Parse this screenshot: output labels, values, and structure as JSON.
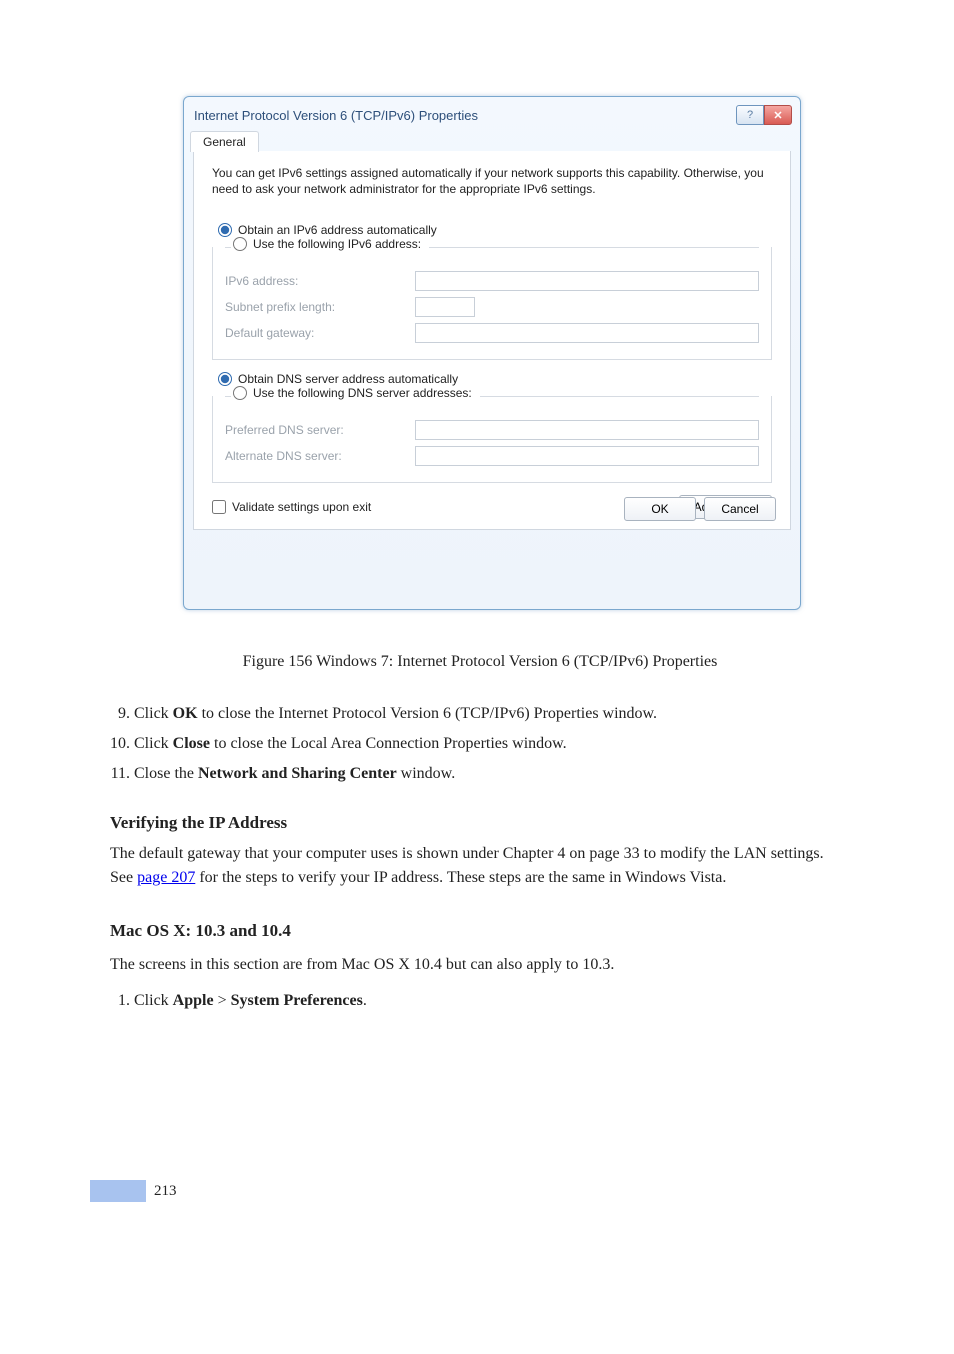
{
  "dialog": {
    "title": "Internet Protocol Version 6 (TCP/IPv6) Properties",
    "tab": "General",
    "description": "You can get IPv6 settings assigned automatically if your network supports this capability. Otherwise, you need to ask your network administrator for the appropriate IPv6 settings.",
    "address": {
      "auto_label": "Obtain an IPv6 address automatically",
      "manual_label": "Use the following IPv6 address:",
      "ipv6_label": "IPv6 address:",
      "prefix_label": "Subnet prefix length:",
      "gateway_label": "Default gateway:",
      "ipv6_value": "",
      "prefix_value": "",
      "gateway_value": ""
    },
    "dns": {
      "auto_label": "Obtain DNS server address automatically",
      "manual_label": "Use the following DNS server addresses:",
      "preferred_label": "Preferred DNS server:",
      "alternate_label": "Alternate DNS server:",
      "preferred_value": "",
      "alternate_value": ""
    },
    "validate_label": "Validate settings upon exit",
    "advanced_label": "Advanced...",
    "ok_label": "OK",
    "cancel_label": "Cancel"
  },
  "figure_caption": "Figure 156   Windows 7: Internet Protocol Version 6 (TCP/IPv6) Properties",
  "steps": {
    "s9_prefix": "Click ",
    "s9_bold": "OK",
    "s9_suffix": " to close the Internet Protocol Version 6 (TCP/IPv6) Properties window.",
    "s10_prefix": "Click ",
    "s10_bold": "Close",
    "s10_suffix": " to close the Local Area Connection Properties window.",
    "s11_prefix": "Close the ",
    "s11_bold": "Network and Sharing Center",
    "s11_suffix": " window.",
    "verify_heading": "Verifying the IP Address",
    "verify_p1_prefix": "The default gateway that your computer uses is shown under ",
    "verify_p1_chapter": "Chapter 4 on page 33",
    "verify_p1_mid": " to modify the LAN settings. See ",
    "verify_p1_link": "page 207",
    "verify_p1_suffix": " for the steps to verify your IP address. These steps are the same in Windows Vista."
  },
  "heading_main": "Mac OS X: 10.3 and 10.4",
  "mac_p1": "The screens in this section are from Mac OS X 10.4 but can also apply to 10.3.",
  "step1_prefix": "Click ",
  "step1_bold1": "Apple",
  "step1_mid": " > ",
  "step1_bold2": "System Preferences",
  "step1_suffix": ".",
  "page_number": "213"
}
